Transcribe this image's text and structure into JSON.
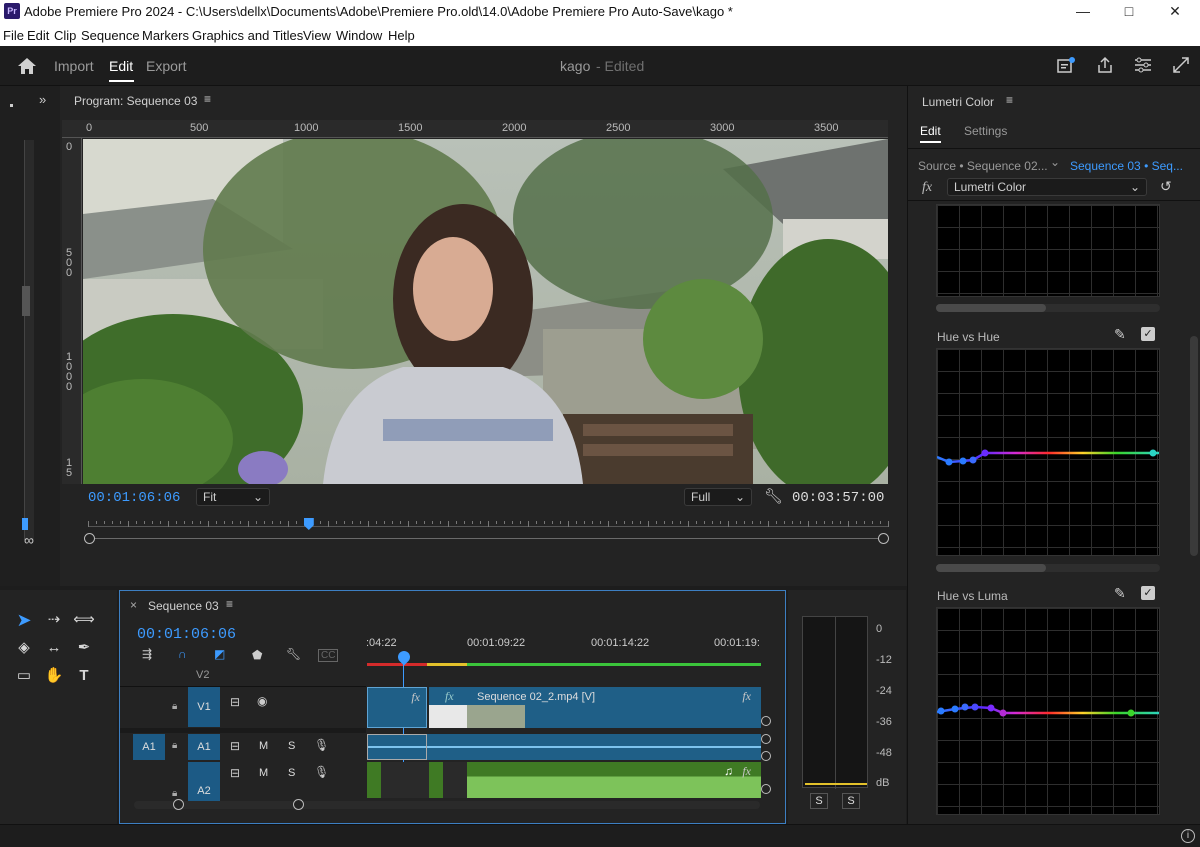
{
  "window": {
    "title": "Adobe Premiere Pro 2024 - C:\\Users\\dellx\\Documents\\Adobe\\Premiere Pro.old\\14.0\\Adobe Premiere Pro Auto-Save\\kago *",
    "app_badge": "Pr",
    "controls": {
      "minimize": "—",
      "maximize": "□",
      "close": "✕"
    }
  },
  "menu": [
    "File",
    "Edit",
    "Clip",
    "Sequence",
    "Markers",
    "Graphics and Titles",
    "View",
    "Window",
    "Help"
  ],
  "appbar": {
    "tabs": [
      "Import",
      "Edit",
      "Export"
    ],
    "active_tab": "Edit",
    "project": "kago",
    "status": "- Edited"
  },
  "program": {
    "title": "Program: Sequence 03",
    "ruler_ticks": [
      "0",
      "500",
      "1000",
      "1500",
      "2000",
      "2500",
      "3000",
      "3500"
    ],
    "vruler_ticks": [
      "0",
      "5\n0\n0",
      "1\n0\n0\n0",
      "1\n5"
    ],
    "timecode_current": "00:01:06:06",
    "timecode_total": "00:03:57:00",
    "zoom": "Fit",
    "resolution": "Full",
    "playhead_fraction": 0.276
  },
  "timeline": {
    "title": "Sequence 03",
    "timecode": "00:01:06:06",
    "ruler_labels": [
      ":04:22",
      "00:01:09:22",
      "00:01:14:22",
      "00:01:19:"
    ],
    "tracks": {
      "v2": "V2",
      "v1": "V1",
      "a1_source": "A1",
      "a1": "A1",
      "a2": "A2",
      "m": "M",
      "s": "S"
    },
    "clip_label": "Sequence 02_2.mp4 [V]",
    "fx": "fx"
  },
  "meter": {
    "scale": [
      "0",
      "-12",
      "-24",
      "-36",
      "-48",
      "dB"
    ],
    "solo": [
      "S",
      "S"
    ]
  },
  "lumetri": {
    "title": "Lumetri Color",
    "tabs": [
      "Edit",
      "Settings"
    ],
    "active_tab": "Edit",
    "source": "Source • Sequence 02...",
    "sequence": "Sequence 03 • Seq...",
    "effect": "Lumetri Color",
    "fx": "fx",
    "curves": [
      "Hue vs Hue",
      "Hue vs Luma"
    ],
    "checkmark": "✓"
  },
  "colors": {
    "accent": "#3d9bff",
    "clip_video": "#1f5f87",
    "clip_audio": "#3f7a24",
    "track_label": "#1c5a85"
  }
}
